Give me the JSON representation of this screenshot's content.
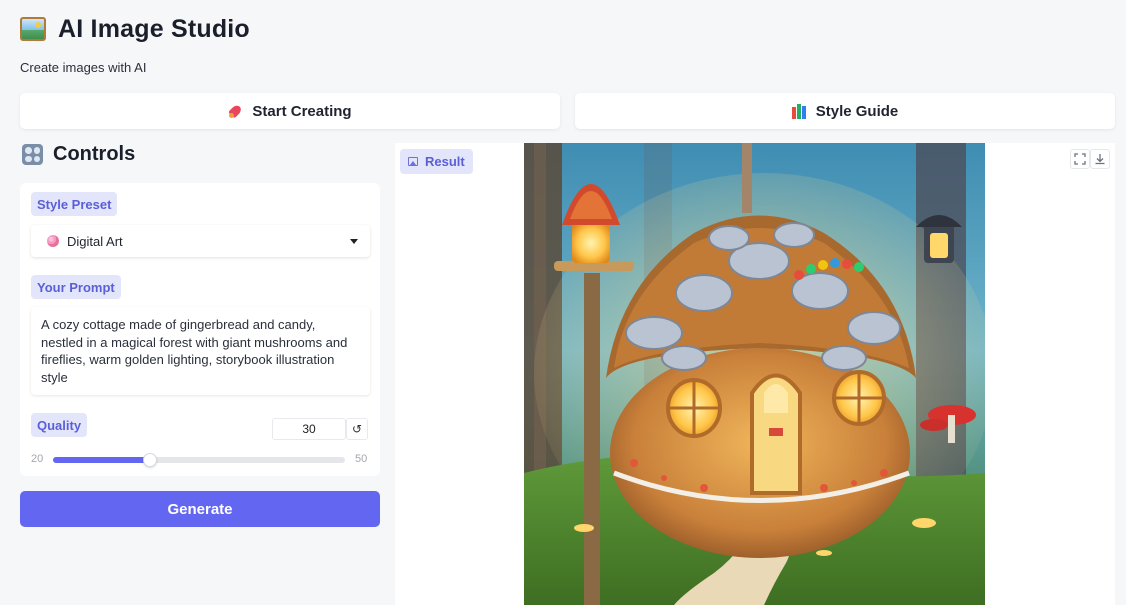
{
  "header": {
    "title": "AI Image Studio",
    "logo_icon": "framed-picture-icon",
    "subtitle": "Create images with AI"
  },
  "tabs": [
    {
      "label": "Start Creating",
      "icon": "rocket-icon"
    },
    {
      "label": "Style Guide",
      "icon": "books-icon"
    }
  ],
  "controls": {
    "title": "Controls",
    "icon": "control-knobs-icon",
    "style_preset": {
      "label": "Style Preset",
      "selected": "Digital Art",
      "icon": "palette-icon"
    },
    "prompt": {
      "label": "Your Prompt",
      "value": "A cozy cottage made of gingerbread and candy, nestled in a magical forest with giant mushrooms and fireflies, warm golden lighting, storybook illustration style"
    },
    "quality": {
      "label": "Quality",
      "value": "30",
      "min": "20",
      "max": "50",
      "reset_symbol": "↺"
    },
    "generate_label": "Generate"
  },
  "result": {
    "label": "Result",
    "icon": "image-icon"
  },
  "colors": {
    "accent": "#6366f1",
    "chip_bg": "#e3e6fb",
    "chip_text": "#5b5fd6",
    "page_bg": "#f6f7f9"
  }
}
